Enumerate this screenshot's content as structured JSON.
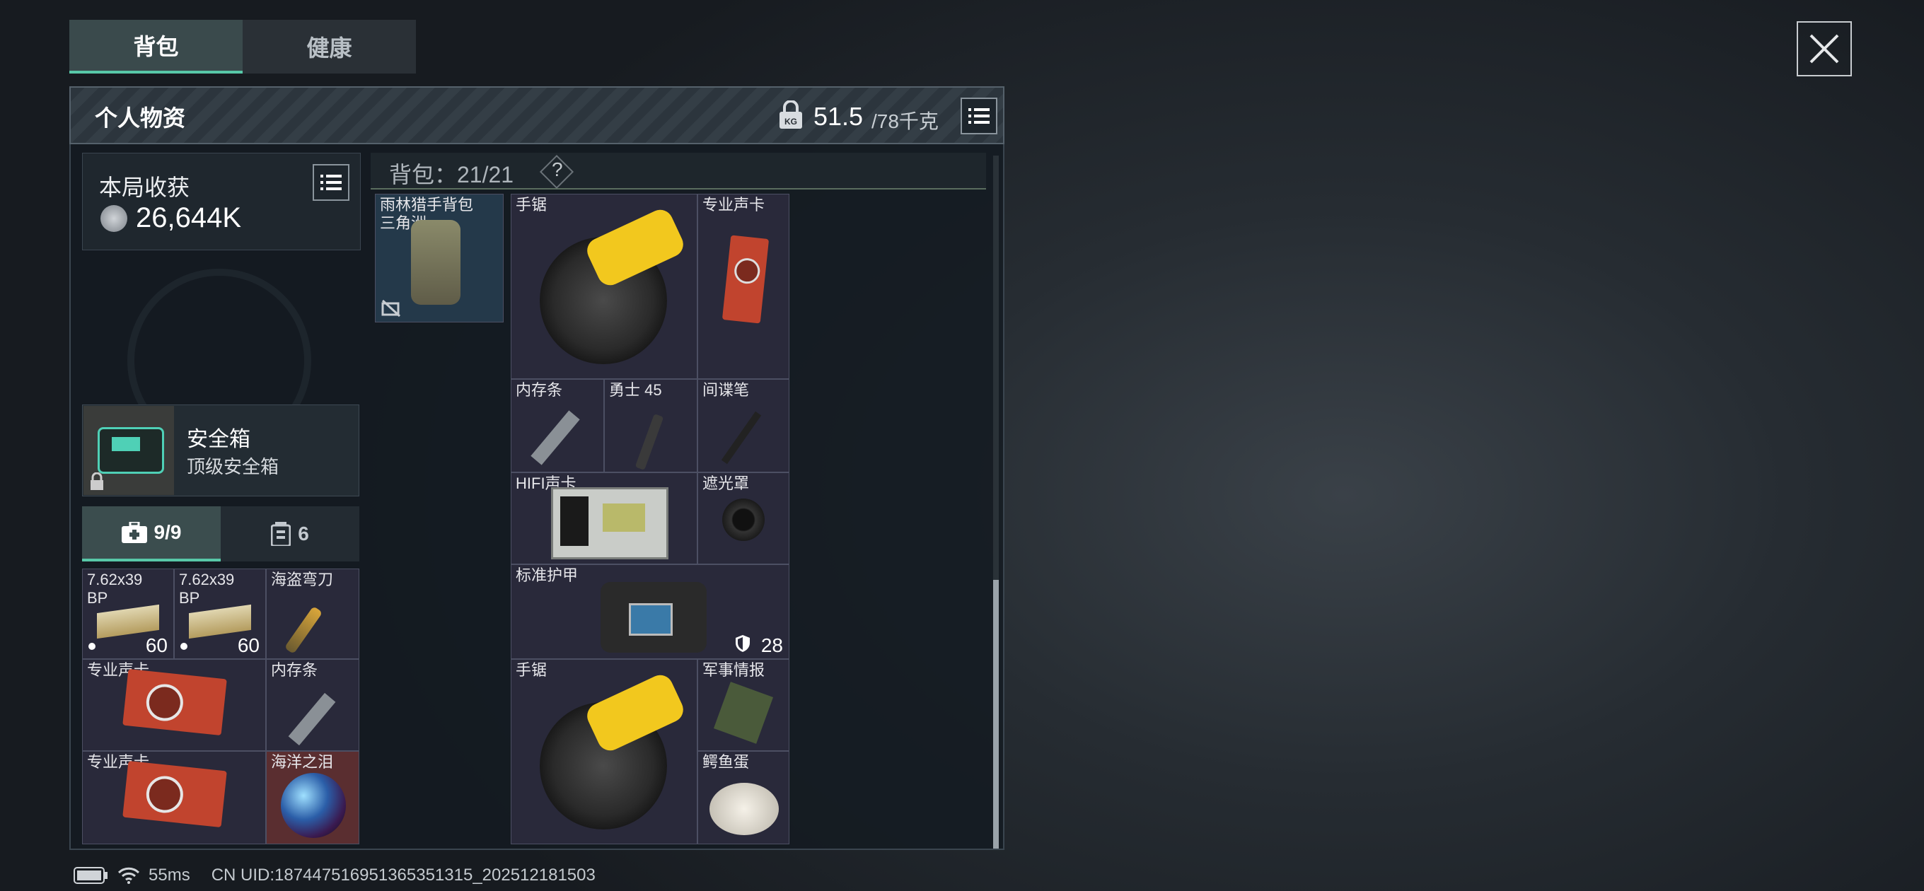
{
  "tabs": {
    "backpack": "背包",
    "health": "健康"
  },
  "header": {
    "title": "个人物资",
    "weight_current": "51.5",
    "weight_max": "/78千克",
    "weight_icon": "KG"
  },
  "harvest": {
    "title": "本局收获",
    "value": "26,644K"
  },
  "safebox": {
    "name": "安全箱",
    "type": "顶级安全箱"
  },
  "subtabs": {
    "medkit_count": "9/9",
    "ammo_count": "6"
  },
  "safe_items": [
    {
      "label": "7.62x39\nBP",
      "count": "60"
    },
    {
      "label": "7.62x39\nBP",
      "count": "60"
    },
    {
      "label": "海盗弯刀"
    },
    {
      "label": "专业声卡"
    },
    {
      "label": "内存条"
    },
    {
      "label": "专业声卡"
    },
    {
      "label": "海洋之泪"
    }
  ],
  "backpack": {
    "title": "背包：21/21",
    "help": "?",
    "bag_label": "雨林猎手背包\n三角洲"
  },
  "items": [
    {
      "label": "手锯"
    },
    {
      "label": "专业声卡"
    },
    {
      "label": "内存条"
    },
    {
      "label": "勇士 45"
    },
    {
      "label": "间谍笔"
    },
    {
      "label": "HIFI声卡"
    },
    {
      "label": "遮光罩"
    },
    {
      "label": "标准护甲",
      "durability": "28"
    },
    {
      "label": "手锯"
    },
    {
      "label": "军事情报"
    },
    {
      "label": "鳄鱼蛋"
    }
  ],
  "footer": {
    "ping": "55ms",
    "uid": "CN UID:187447516951365351315_202512181503"
  },
  "colors": {
    "accent": "#58c8a8",
    "cell_bg": "#29293a",
    "red_cell": "#5a2e30"
  }
}
